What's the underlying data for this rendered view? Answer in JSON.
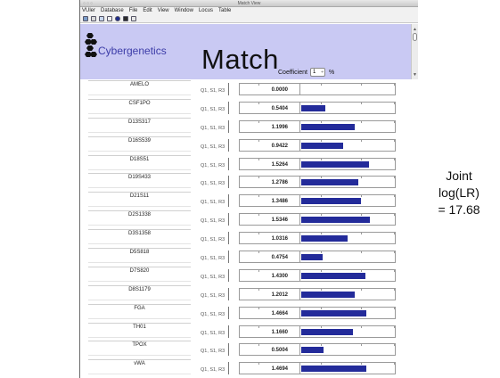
{
  "window": {
    "title": "Match View",
    "buttons": "○○○"
  },
  "menu": [
    "VUler",
    "Database",
    "File",
    "Edit",
    "View",
    "Window",
    "Locus",
    "Table"
  ],
  "toolbar": {
    "icons": [
      "open-icon",
      "save-icon",
      "chart-icon",
      "table-icon",
      "run-icon",
      "stop-icon",
      "grid-icon"
    ]
  },
  "header": {
    "brand": "Cybergenetics",
    "title": "Match",
    "coefficient_label": "Coefficient",
    "coefficient_value": "1",
    "coefficient_arrows": "÷",
    "percent": "%",
    "background": "#c9c9f3"
  },
  "scrollbar": {
    "up": "▲",
    "down": "▼"
  },
  "loci": [
    {
      "name": "AMELO",
      "params": "Q1, S1, R3",
      "value": "0.0000",
      "lr": 0.0
    },
    {
      "name": "CSF1PO",
      "params": "Q1, S1, R3",
      "value": "0.5404",
      "lr": 0.5404
    },
    {
      "name": "D13S317",
      "params": "Q1, S1, R3",
      "value": "1.1996",
      "lr": 1.1996
    },
    {
      "name": "D16S539",
      "params": "Q1, S1, R3",
      "value": "0.9422",
      "lr": 0.9422
    },
    {
      "name": "D18S51",
      "params": "Q1, S1, R3",
      "value": "1.5264",
      "lr": 1.5264
    },
    {
      "name": "D19S433",
      "params": "Q1, S1, R3",
      "value": "1.2786",
      "lr": 1.2786
    },
    {
      "name": "D21S11",
      "params": "Q1, S1, R3",
      "value": "1.3486",
      "lr": 1.3486
    },
    {
      "name": "D2S1338",
      "params": "Q1, S1, R3",
      "value": "1.5346",
      "lr": 1.5346
    },
    {
      "name": "D3S1358",
      "params": "Q1, S1, R3",
      "value": "1.0316",
      "lr": 1.0316
    },
    {
      "name": "D5S818",
      "params": "Q1, S1, R3",
      "value": "0.4754",
      "lr": 0.4754
    },
    {
      "name": "D7S820",
      "params": "Q1, S1, R3",
      "value": "1.4300",
      "lr": 1.43
    },
    {
      "name": "D8S1179",
      "params": "Q1, S1, R3",
      "value": "1.2012",
      "lr": 1.2012
    },
    {
      "name": "FGA",
      "params": "Q1, S1, R3",
      "value": "1.4664",
      "lr": 1.4664
    },
    {
      "name": "TH01",
      "params": "Q1, S1, R3",
      "value": "1.1660",
      "lr": 1.166
    },
    {
      "name": "TPOX",
      "params": "Q1, S1, R3",
      "value": "0.5004",
      "lr": 0.5004
    },
    {
      "name": "vWA",
      "params": "Q1, S1, R3",
      "value": "1.4694",
      "lr": 1.4694
    }
  ],
  "lr_scale_max": 2.0,
  "bar_color": "#232b9a",
  "result": {
    "line1": "Joint",
    "line2": "log(LR)",
    "line3": "= 17.68"
  }
}
